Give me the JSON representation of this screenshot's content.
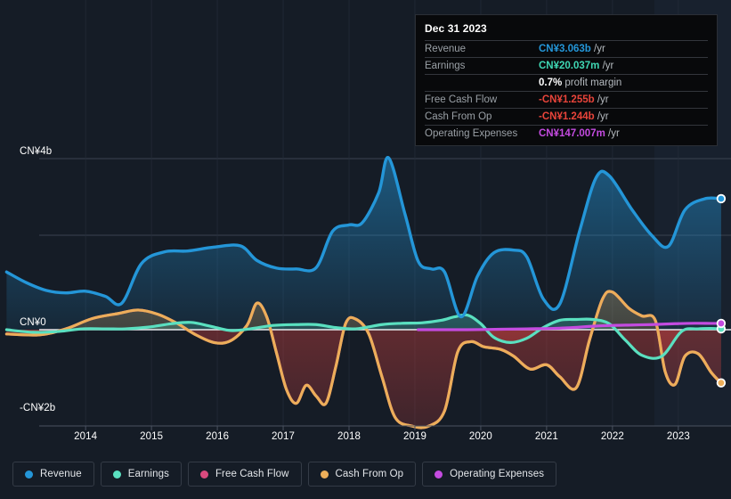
{
  "chart_data": {
    "type": "area",
    "title": "",
    "xlabel": "",
    "ylabel": "",
    "currency": "CN¥",
    "grid": true,
    "legend_position": "bottom",
    "x_ticks": [
      "2014",
      "2015",
      "2016",
      "2017",
      "2018",
      "2019",
      "2020",
      "2021",
      "2022",
      "2023"
    ],
    "y_ticks": [
      "CN¥4b",
      "CN¥0",
      "-CN¥2b"
    ],
    "ylim": [
      -2.4,
      4.2
    ],
    "xlim": [
      2013.2,
      2024.3
    ],
    "series": [
      {
        "name": "Revenue",
        "color": "#2496d8",
        "end_value": "CN¥3.063b",
        "points": [
          [
            2013.3,
            1.35
          ],
          [
            2013.6,
            1.1
          ],
          [
            2013.9,
            0.92
          ],
          [
            2014.2,
            0.86
          ],
          [
            2014.5,
            0.9
          ],
          [
            2014.8,
            0.78
          ],
          [
            2015.05,
            0.62
          ],
          [
            2015.35,
            1.55
          ],
          [
            2015.7,
            1.82
          ],
          [
            2016.05,
            1.84
          ],
          [
            2016.45,
            1.93
          ],
          [
            2016.85,
            1.96
          ],
          [
            2017.1,
            1.62
          ],
          [
            2017.4,
            1.44
          ],
          [
            2017.7,
            1.42
          ],
          [
            2018.0,
            1.45
          ],
          [
            2018.25,
            2.3
          ],
          [
            2018.5,
            2.45
          ],
          [
            2018.7,
            2.5
          ],
          [
            2018.95,
            3.2
          ],
          [
            2019.1,
            4.02
          ],
          [
            2019.35,
            2.7
          ],
          [
            2019.55,
            1.6
          ],
          [
            2019.75,
            1.42
          ],
          [
            2019.95,
            1.35
          ],
          [
            2020.2,
            0.3
          ],
          [
            2020.45,
            1.25
          ],
          [
            2020.7,
            1.8
          ],
          [
            2021.0,
            1.86
          ],
          [
            2021.2,
            1.7
          ],
          [
            2021.45,
            0.72
          ],
          [
            2021.7,
            0.6
          ],
          [
            2022.0,
            2.3
          ],
          [
            2022.25,
            3.55
          ],
          [
            2022.45,
            3.6
          ],
          [
            2022.8,
            2.8
          ],
          [
            2023.1,
            2.2
          ],
          [
            2023.35,
            1.95
          ],
          [
            2023.6,
            2.8
          ],
          [
            2023.9,
            3.06
          ],
          [
            2024.15,
            3.063
          ]
        ]
      },
      {
        "name": "Earnings",
        "color": "#5ae0c0",
        "end_value": "CN¥20.037m",
        "points": [
          [
            2013.3,
            0.0
          ],
          [
            2013.7,
            -0.06
          ],
          [
            2014.1,
            -0.04
          ],
          [
            2014.45,
            0.02
          ],
          [
            2014.8,
            0.02
          ],
          [
            2015.1,
            0.02
          ],
          [
            2015.45,
            0.06
          ],
          [
            2015.8,
            0.14
          ],
          [
            2016.1,
            0.17
          ],
          [
            2016.4,
            0.08
          ],
          [
            2016.7,
            -0.02
          ],
          [
            2017.0,
            0.02
          ],
          [
            2017.35,
            0.1
          ],
          [
            2017.7,
            0.12
          ],
          [
            2018.0,
            0.12
          ],
          [
            2018.3,
            0.05
          ],
          [
            2018.6,
            0.02
          ],
          [
            2019.0,
            0.12
          ],
          [
            2019.3,
            0.15
          ],
          [
            2019.6,
            0.16
          ],
          [
            2019.9,
            0.22
          ],
          [
            2020.1,
            0.3
          ],
          [
            2020.3,
            0.34
          ],
          [
            2020.5,
            0.14
          ],
          [
            2020.7,
            -0.18
          ],
          [
            2020.95,
            -0.3
          ],
          [
            2021.2,
            -0.2
          ],
          [
            2021.45,
            0.05
          ],
          [
            2021.7,
            0.22
          ],
          [
            2021.95,
            0.24
          ],
          [
            2022.2,
            0.24
          ],
          [
            2022.45,
            0.14
          ],
          [
            2022.7,
            -0.25
          ],
          [
            2022.95,
            -0.6
          ],
          [
            2023.25,
            -0.62
          ],
          [
            2023.55,
            -0.04
          ],
          [
            2023.8,
            0.02
          ],
          [
            2024.0,
            0.03
          ],
          [
            2024.15,
            0.02
          ]
        ]
      },
      {
        "name": "Free Cash Flow",
        "color": "#d94a7e",
        "end_value": "-CN¥1.255b",
        "points": [
          [
            2013.3,
            -0.1
          ],
          [
            2013.8,
            -0.12
          ],
          [
            2014.2,
            0.02
          ],
          [
            2014.6,
            0.26
          ],
          [
            2015.0,
            0.38
          ],
          [
            2015.3,
            0.46
          ],
          [
            2015.6,
            0.36
          ],
          [
            2015.9,
            0.14
          ],
          [
            2016.15,
            -0.1
          ],
          [
            2016.45,
            -0.3
          ],
          [
            2016.7,
            -0.26
          ],
          [
            2016.95,
            0.1
          ],
          [
            2017.1,
            0.62
          ],
          [
            2017.25,
            0.3
          ],
          [
            2017.4,
            -0.55
          ],
          [
            2017.55,
            -1.4
          ],
          [
            2017.7,
            -1.72
          ],
          [
            2017.85,
            -1.3
          ],
          [
            2018.0,
            -1.55
          ],
          [
            2018.15,
            -1.72
          ],
          [
            2018.3,
            -0.86
          ],
          [
            2018.45,
            0.15
          ],
          [
            2018.6,
            0.25
          ],
          [
            2018.8,
            -0.1
          ],
          [
            2019.0,
            -1.1
          ],
          [
            2019.2,
            -2.05
          ],
          [
            2019.45,
            -2.25
          ],
          [
            2019.7,
            -2.26
          ],
          [
            2019.95,
            -1.9
          ],
          [
            2020.15,
            -0.52
          ],
          [
            2020.35,
            -0.28
          ],
          [
            2020.55,
            -0.4
          ],
          [
            2020.8,
            -0.46
          ],
          [
            2021.0,
            -0.62
          ],
          [
            2021.25,
            -0.92
          ],
          [
            2021.5,
            -0.82
          ],
          [
            2021.7,
            -1.1
          ],
          [
            2021.95,
            -1.36
          ],
          [
            2022.15,
            -0.25
          ],
          [
            2022.35,
            0.72
          ],
          [
            2022.5,
            0.88
          ],
          [
            2022.75,
            0.5
          ],
          [
            2022.95,
            0.32
          ],
          [
            2023.15,
            0.22
          ],
          [
            2023.3,
            -0.98
          ],
          [
            2023.45,
            -1.28
          ],
          [
            2023.6,
            -0.62
          ],
          [
            2023.8,
            -0.56
          ],
          [
            2024.0,
            -1.0
          ],
          [
            2024.15,
            -1.255
          ]
        ]
      },
      {
        "name": "Cash From Op",
        "color": "#ecae5a",
        "end_value": "-CN¥1.244b",
        "points": [
          [
            2013.3,
            -0.1
          ],
          [
            2013.8,
            -0.12
          ],
          [
            2014.2,
            0.02
          ],
          [
            2014.6,
            0.26
          ],
          [
            2015.0,
            0.38
          ],
          [
            2015.3,
            0.46
          ],
          [
            2015.6,
            0.36
          ],
          [
            2015.9,
            0.14
          ],
          [
            2016.15,
            -0.1
          ],
          [
            2016.45,
            -0.3
          ],
          [
            2016.7,
            -0.26
          ],
          [
            2016.95,
            0.1
          ],
          [
            2017.1,
            0.62
          ],
          [
            2017.25,
            0.3
          ],
          [
            2017.4,
            -0.55
          ],
          [
            2017.55,
            -1.4
          ],
          [
            2017.7,
            -1.72
          ],
          [
            2017.85,
            -1.3
          ],
          [
            2018.0,
            -1.55
          ],
          [
            2018.15,
            -1.72
          ],
          [
            2018.3,
            -0.86
          ],
          [
            2018.45,
            0.15
          ],
          [
            2018.6,
            0.25
          ],
          [
            2018.8,
            -0.1
          ],
          [
            2019.0,
            -1.1
          ],
          [
            2019.2,
            -2.05
          ],
          [
            2019.45,
            -2.25
          ],
          [
            2019.7,
            -2.26
          ],
          [
            2019.95,
            -1.9
          ],
          [
            2020.15,
            -0.52
          ],
          [
            2020.35,
            -0.28
          ],
          [
            2020.55,
            -0.4
          ],
          [
            2020.8,
            -0.46
          ],
          [
            2021.0,
            -0.62
          ],
          [
            2021.25,
            -0.92
          ],
          [
            2021.5,
            -0.82
          ],
          [
            2021.7,
            -1.1
          ],
          [
            2021.95,
            -1.36
          ],
          [
            2022.15,
            -0.25
          ],
          [
            2022.35,
            0.72
          ],
          [
            2022.5,
            0.88
          ],
          [
            2022.75,
            0.5
          ],
          [
            2022.95,
            0.32
          ],
          [
            2023.15,
            0.22
          ],
          [
            2023.3,
            -0.98
          ],
          [
            2023.45,
            -1.28
          ],
          [
            2023.6,
            -0.62
          ],
          [
            2023.8,
            -0.56
          ],
          [
            2024.0,
            -1.0
          ],
          [
            2024.15,
            -1.244
          ]
        ]
      },
      {
        "name": "Operating Expenses",
        "color": "#c44be0",
        "end_value": "CN¥147.007m",
        "points": [
          [
            2019.55,
            0.0
          ],
          [
            2019.9,
            0.0
          ],
          [
            2020.3,
            0.0
          ],
          [
            2020.8,
            0.01
          ],
          [
            2021.2,
            0.02
          ],
          [
            2021.6,
            0.03
          ],
          [
            2021.9,
            0.05
          ],
          [
            2022.2,
            0.08
          ],
          [
            2022.5,
            0.1
          ],
          [
            2022.8,
            0.11
          ],
          [
            2023.1,
            0.12
          ],
          [
            2023.45,
            0.14
          ],
          [
            2023.75,
            0.15
          ],
          [
            2024.0,
            0.147
          ],
          [
            2024.15,
            0.147
          ]
        ]
      }
    ]
  },
  "tooltip": {
    "title": "Dec 31 2023",
    "rows": [
      {
        "key": "Revenue",
        "amount": "CN¥3.063b",
        "unit": "/yr",
        "color": "#2496d8"
      },
      {
        "key": "Earnings",
        "amount": "CN¥20.037m",
        "unit": "/yr",
        "color": "#3fd8b4"
      },
      {
        "key": "",
        "amount": "0.7%",
        "unit": "profit margin",
        "color": "#ffffff"
      },
      {
        "key": "Free Cash Flow",
        "amount": "-CN¥1.255b",
        "unit": "/yr",
        "color": "#e8443a"
      },
      {
        "key": "Cash From Op",
        "amount": "-CN¥1.244b",
        "unit": "/yr",
        "color": "#e8443a"
      },
      {
        "key": "Operating Expenses",
        "amount": "CN¥147.007m",
        "unit": "/yr",
        "color": "#c44be0"
      }
    ]
  },
  "legend": {
    "items": [
      {
        "label": "Revenue",
        "color": "#2496d8"
      },
      {
        "label": "Earnings",
        "color": "#5ae0c0"
      },
      {
        "label": "Free Cash Flow",
        "color": "#d94a7e"
      },
      {
        "label": "Cash From Op",
        "color": "#ecae5a"
      },
      {
        "label": "Operating Expenses",
        "color": "#c44be0"
      }
    ]
  },
  "axes": {
    "y_labels": [
      {
        "text": "CN¥4b",
        "value": 4
      },
      {
        "text": "CN¥0",
        "value": 0
      },
      {
        "text": "-CN¥2b",
        "value": -2
      }
    ],
    "x_labels": [
      "2014",
      "2015",
      "2016",
      "2017",
      "2018",
      "2019",
      "2020",
      "2021",
      "2022",
      "2023"
    ]
  }
}
